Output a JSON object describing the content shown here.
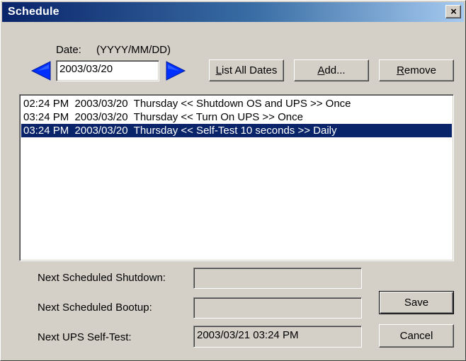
{
  "window": {
    "title": "Schedule",
    "close_label": "×"
  },
  "date": {
    "label": "Date:",
    "format_hint": "(YYYY/MM/DD)",
    "value": "2003/03/20"
  },
  "buttons": {
    "list_all_dates": {
      "accel": "L",
      "rest": "ist All Dates"
    },
    "add": {
      "accel": "A",
      "rest": "dd..."
    },
    "remove": {
      "accel": "R",
      "rest": "emove"
    },
    "save": "Save",
    "cancel": "Cancel"
  },
  "schedule_list": {
    "items": [
      {
        "text": "02:24 PM  2003/03/20  Thursday << Shutdown OS and UPS >> Once",
        "selected": false
      },
      {
        "text": "03:24 PM  2003/03/20  Thursday << Turn On UPS >> Once",
        "selected": false
      },
      {
        "text": "03:24 PM  2003/03/20  Thursday << Self-Test 10 seconds >> Daily",
        "selected": true
      }
    ]
  },
  "next": {
    "shutdown_label": "Next Scheduled Shutdown:",
    "shutdown_value": "",
    "bootup_label": "Next Scheduled Bootup:",
    "bootup_value": "",
    "selftest_label": "Next UPS Self-Test:",
    "selftest_value": "2003/03/21 03:24 PM"
  },
  "colors": {
    "title_bar_start": "#0a246a",
    "arrow_blue": "#0030ff",
    "selection": "#0a246a",
    "face": "#d4d0c8"
  }
}
